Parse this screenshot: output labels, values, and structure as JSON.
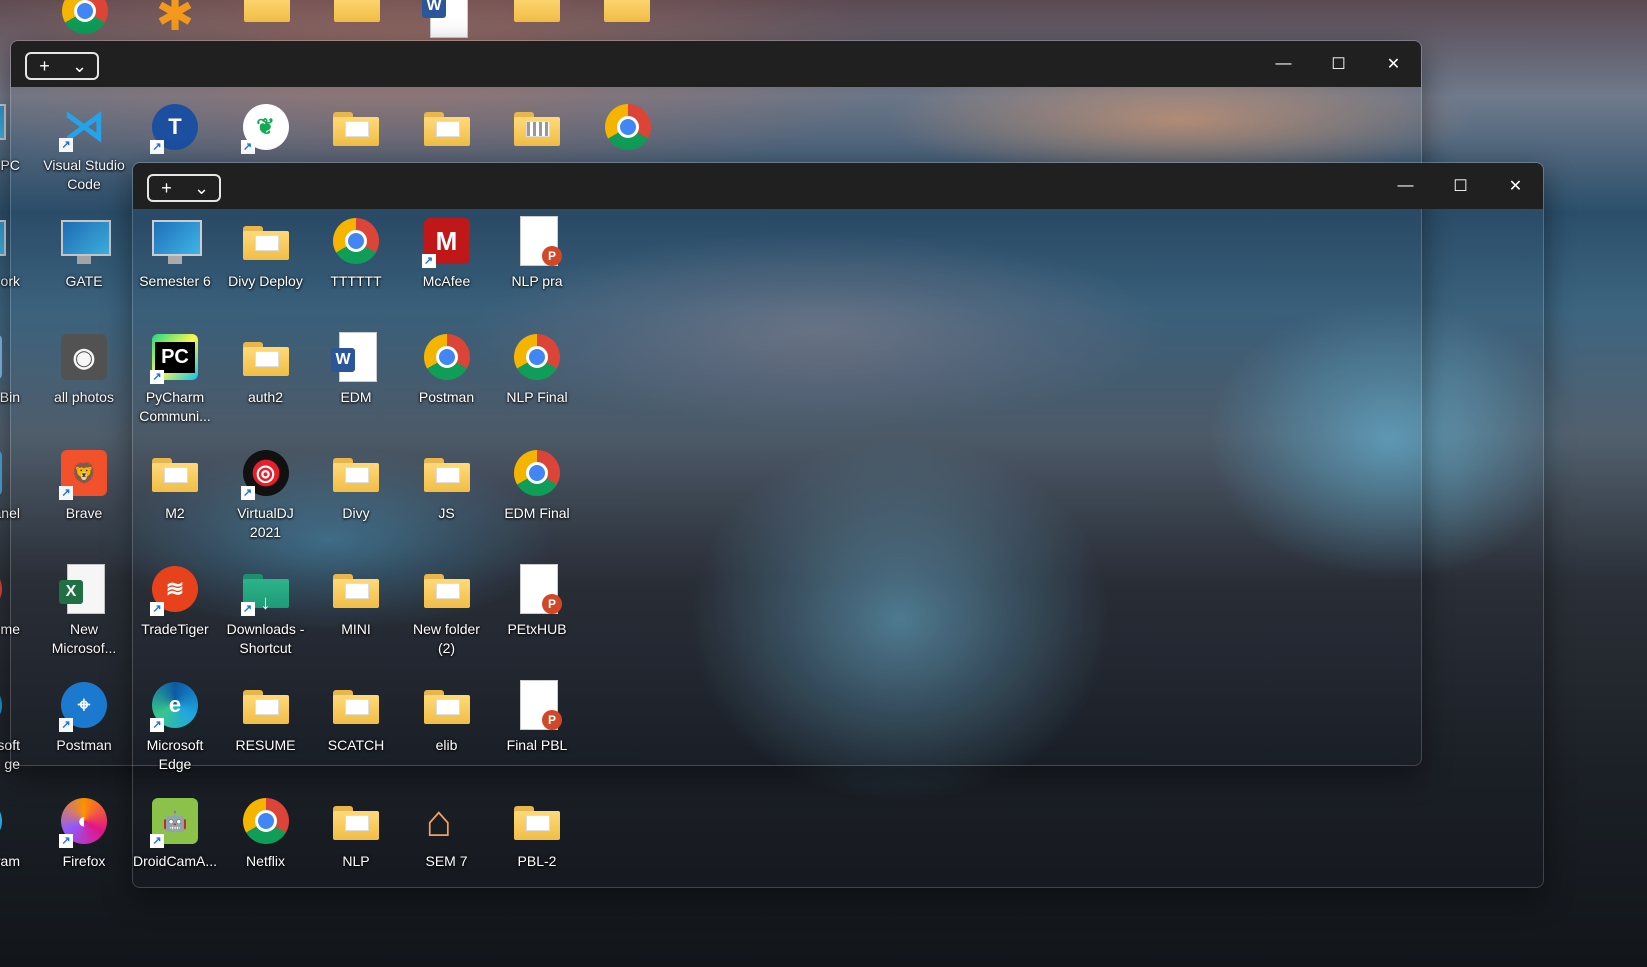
{
  "desktop_left_column": [
    {
      "label": "PC",
      "icon": "monitor-icon"
    },
    {
      "label": "ork",
      "icon": "monitor-icon"
    },
    {
      "label": "e Bin",
      "icon": "recycle-bin-icon"
    },
    {
      "label": "Panel",
      "icon": "control-panel-icon"
    },
    {
      "label": "me",
      "icon": "chrome-icon"
    },
    {
      "label": "soft\nge",
      "icon": "edge-icon"
    },
    {
      "label": "ram",
      "icon": "telegram-icon"
    }
  ],
  "desktop_column_2": [
    {
      "label": "Visual Studio\nCode",
      "icon": "vscode-icon"
    },
    {
      "label": "GATE",
      "icon": "monitor-icon"
    },
    {
      "label": "all photos",
      "icon": "camera-icon"
    },
    {
      "label": "Brave",
      "icon": "brave-icon"
    },
    {
      "label": "New\nMicrosof...",
      "icon": "excel-icon"
    },
    {
      "label": "Postman",
      "icon": "postman-icon"
    },
    {
      "label": "Firefox",
      "icon": "firefox-icon"
    }
  ],
  "back_window_top_row": [
    "ts-icon",
    "mongodb-icon",
    "folder-icon",
    "folder-icon",
    "zip-folder-icon",
    "chrome-icon"
  ],
  "window_back": {
    "minimize": "—",
    "maximize": "☐",
    "close": "✕"
  },
  "window_front": {
    "minimize": "—",
    "maximize": "☐",
    "close": "✕"
  },
  "grid": [
    [
      {
        "label": "Semester 6",
        "icon": "monitor-icon"
      },
      {
        "label": "Divy Deploy",
        "icon": "folder-icon"
      },
      {
        "label": "TTTTTT",
        "icon": "chrome-icon"
      },
      {
        "label": "McAfee",
        "icon": "mcafee-icon"
      },
      {
        "label": "NLP pra",
        "icon": "powerpoint-icon"
      }
    ],
    [
      {
        "label": "PyCharm\nCommuni...",
        "icon": "pycharm-icon"
      },
      {
        "label": "auth2",
        "icon": "folder-icon"
      },
      {
        "label": "EDM",
        "icon": "word-icon"
      },
      {
        "label": "Postman",
        "icon": "chrome-icon"
      },
      {
        "label": "NLP Final",
        "icon": "chrome-icon"
      }
    ],
    [
      {
        "label": "M2",
        "icon": "folder-icon"
      },
      {
        "label": "VirtualDJ\n2021",
        "icon": "virtualdj-icon"
      },
      {
        "label": "Divy",
        "icon": "folder-icon"
      },
      {
        "label": "JS",
        "icon": "folder-icon"
      },
      {
        "label": "EDM Final",
        "icon": "chrome-icon"
      }
    ],
    [
      {
        "label": "TradeTiger",
        "icon": "tradetiger-icon"
      },
      {
        "label": "Downloads -\nShortcut",
        "icon": "downloads-folder-icon"
      },
      {
        "label": "MINI",
        "icon": "folder-icon"
      },
      {
        "label": "New folder\n(2)",
        "icon": "folder-icon"
      },
      {
        "label": "PEtxHUB",
        "icon": "powerpoint-icon"
      }
    ],
    [
      {
        "label": "Microsoft\nEdge",
        "icon": "edge-icon"
      },
      {
        "label": "RESUME",
        "icon": "folder-icon"
      },
      {
        "label": "SCATCH",
        "icon": "folder-icon"
      },
      {
        "label": "elib",
        "icon": "folder-icon"
      },
      {
        "label": "Final PBL",
        "icon": "powerpoint-icon"
      }
    ],
    [
      {
        "label": "DroidCamA...",
        "icon": "droidcam-icon"
      },
      {
        "label": "Netflix",
        "icon": "chrome-icon"
      },
      {
        "label": "NLP",
        "icon": "folder-icon"
      },
      {
        "label": "SEM 7",
        "icon": "home-icon"
      },
      {
        "label": "PBL-2",
        "icon": "folder-icon"
      }
    ]
  ],
  "colors": {
    "titlebar": "#202020",
    "accent": "#1a73e8"
  }
}
